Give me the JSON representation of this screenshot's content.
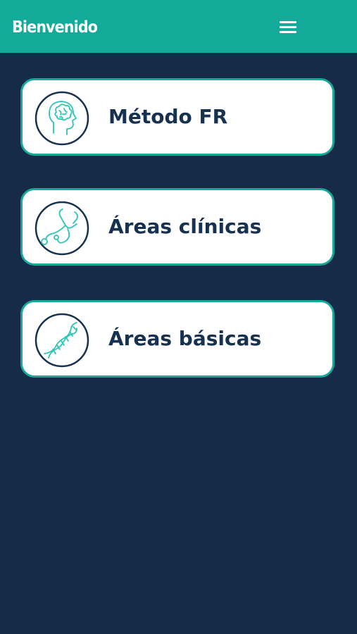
{
  "appbar": {
    "title": "Bienvenido",
    "menu_icon": "hamburger-menu-icon",
    "background": "#13aa9a"
  },
  "cards": [
    {
      "label": "Método FR",
      "icon": "brain-head-icon"
    },
    {
      "label": "Áreas clínicas",
      "icon": "stethoscope-icon"
    },
    {
      "label": "Áreas básicas",
      "icon": "dna-icon"
    }
  ],
  "colors": {
    "page_background": "#152b47",
    "accent": "#19a99b",
    "text": "#163250"
  }
}
